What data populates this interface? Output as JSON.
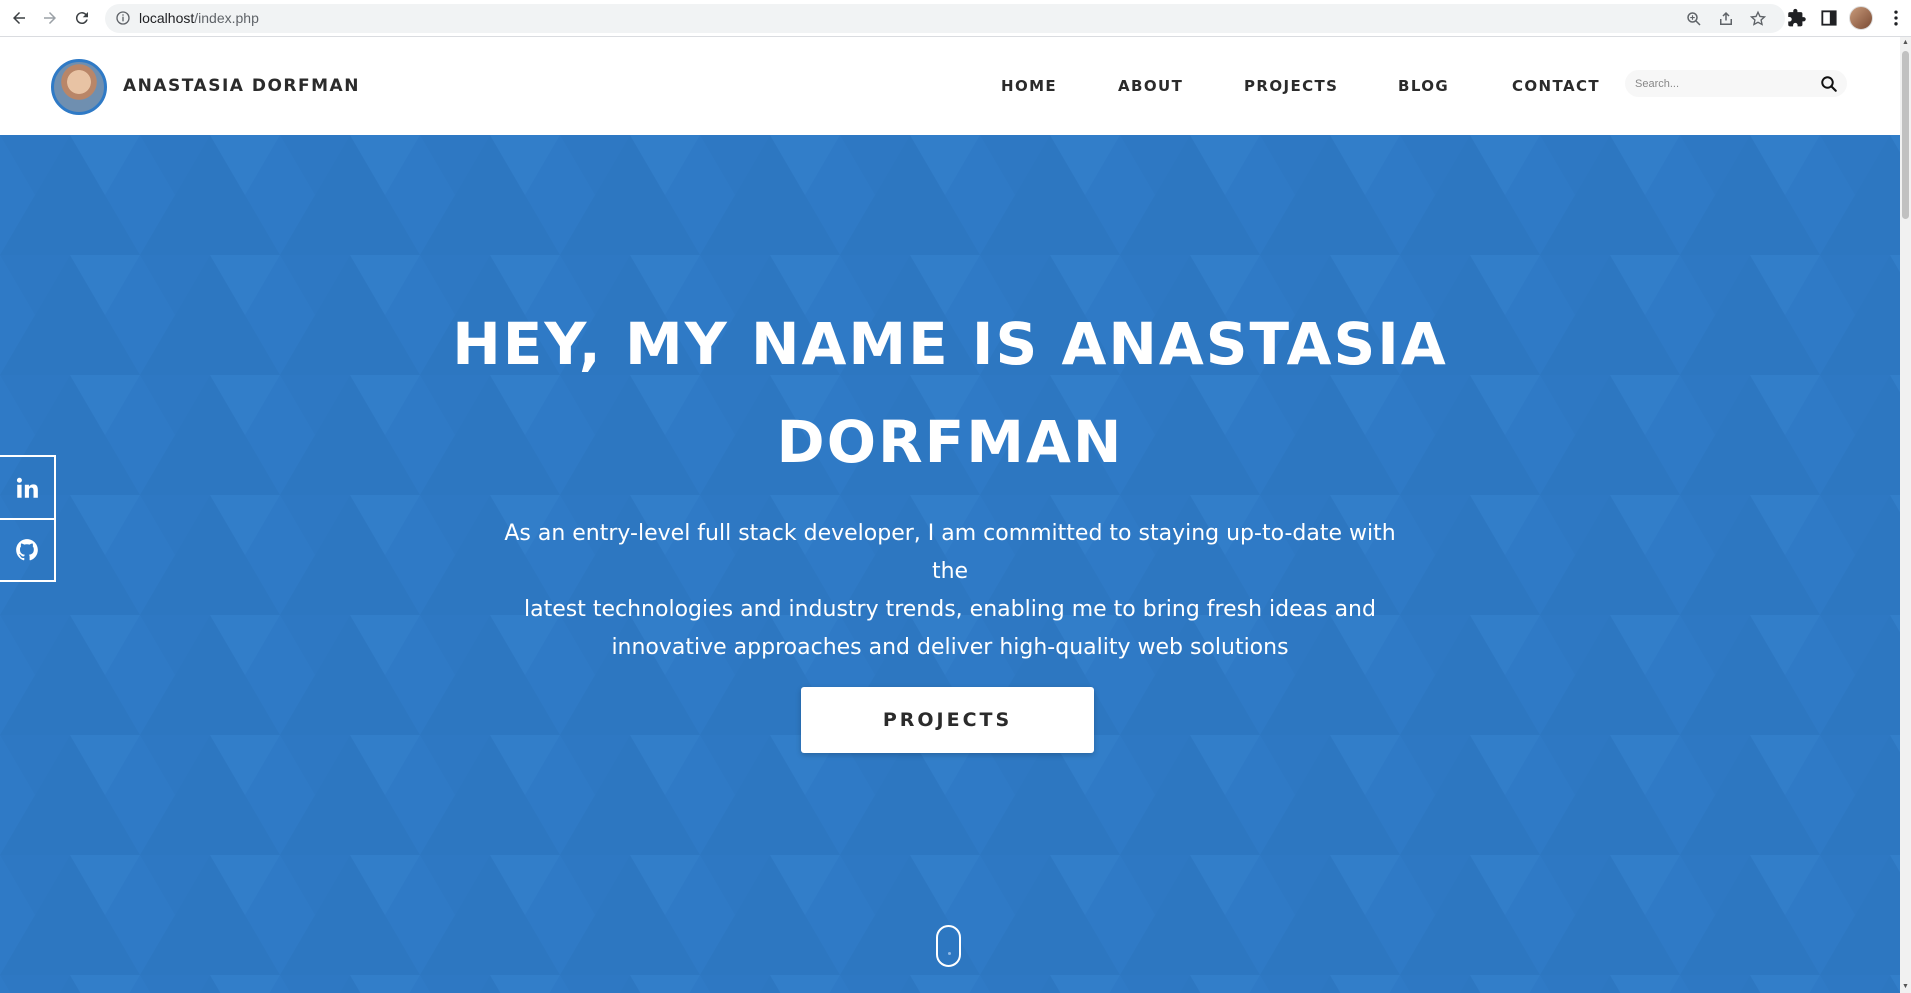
{
  "browser": {
    "url_host": "localhost",
    "url_path": "/index.php",
    "icons": [
      "back-icon",
      "forward-icon",
      "reload-icon",
      "info-icon",
      "zoom-icon",
      "share-icon",
      "star-icon",
      "extensions-icon",
      "sidepanel-icon",
      "profile-avatar",
      "more-icon"
    ]
  },
  "header": {
    "brand": "ANASTASIA DORFMAN",
    "nav": [
      {
        "label": "HOME"
      },
      {
        "label": "ABOUT"
      },
      {
        "label": "PROJECTS"
      },
      {
        "label": "BLOG"
      },
      {
        "label": "CONTACT"
      }
    ],
    "search_placeholder": "Search..."
  },
  "hero": {
    "title_line1": "HEY, MY NAME IS ANASTASIA",
    "title_line2": "DORFMAN",
    "text_line1": "As an entry-level full stack developer, I am committed to staying up-to-date with the",
    "text_line2": "latest technologies and industry trends, enabling me to bring fresh ideas and",
    "text_line3": "innovative approaches and deliver high-quality web solutions",
    "button_label": "PROJECTS",
    "background_color": "#2f7ac6"
  },
  "social": {
    "icons": [
      "linkedin-icon",
      "github-icon"
    ]
  }
}
